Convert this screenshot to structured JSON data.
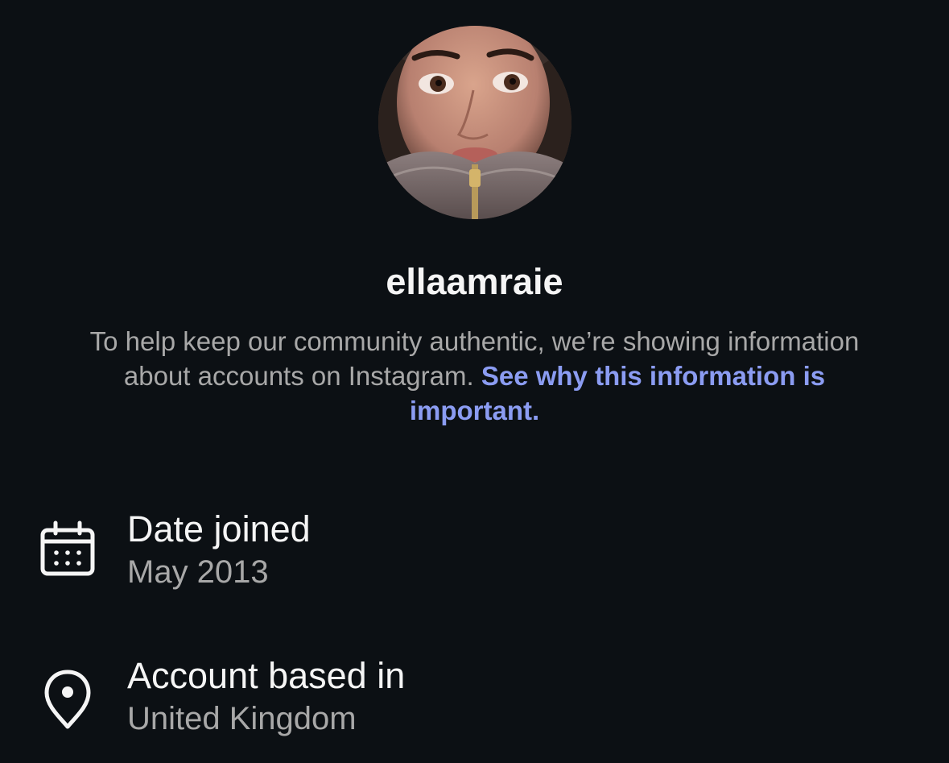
{
  "profile": {
    "username": "ellaamraie"
  },
  "notice": {
    "text": "To help keep our community authentic, we’re showing information about accounts on Instagram.",
    "link_text": "See why this information is important."
  },
  "details": {
    "date_joined": {
      "label": "Date joined",
      "value": "May 2013",
      "icon": "calendar-icon"
    },
    "account_based_in": {
      "label": "Account based in",
      "value": "United Kingdom",
      "icon": "location-pin-icon"
    }
  },
  "colors": {
    "background": "#0c1014",
    "primary_text": "#f5f5f5",
    "secondary_text": "#a8a8a8",
    "link": "#8b9cf2"
  }
}
